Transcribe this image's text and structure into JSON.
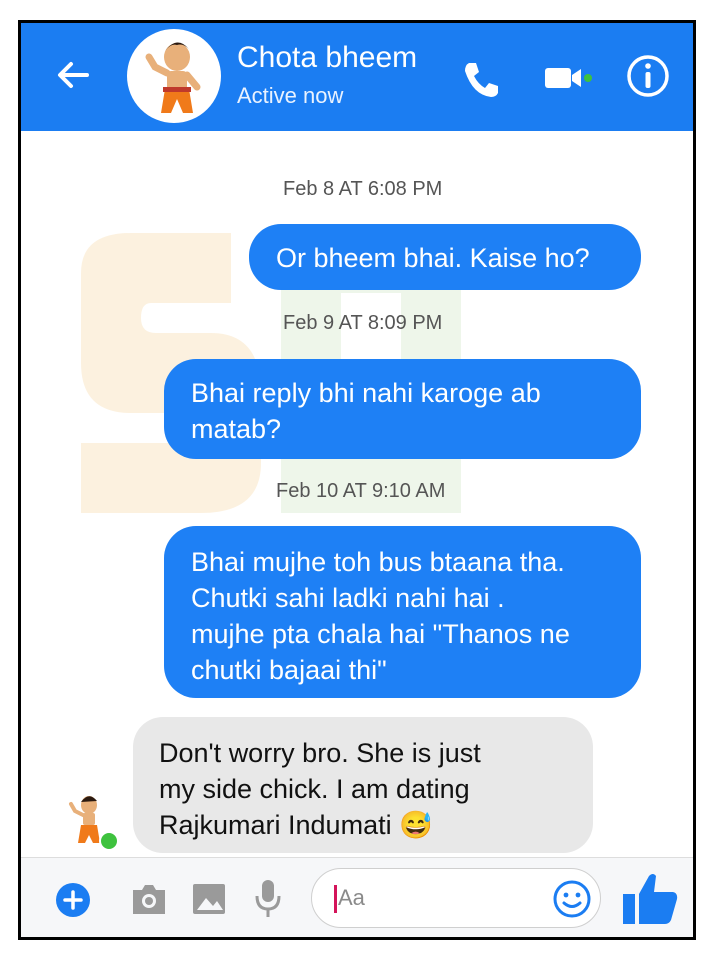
{
  "header": {
    "title": "Chota bheem",
    "status": "Active now"
  },
  "messages": [
    {
      "kind": "timestamp",
      "text": "Feb 8 AT 6:08 PM"
    },
    {
      "kind": "outgoing",
      "text": "Or bheem bhai. Kaise ho?"
    },
    {
      "kind": "timestamp",
      "text": "Feb 9 AT 8:09 PM"
    },
    {
      "kind": "outgoing",
      "text": "Bhai reply bhi nahi karoge ab matab?"
    },
    {
      "kind": "timestamp",
      "text": "Feb 10 AT 9:10 AM"
    },
    {
      "kind": "outgoing",
      "text": "Bhai mujhe toh bus btaana tha. Chutki sahi ladki nahi hai . mujhe pta chala hai \"Thanos ne chutki bajaai thi\""
    },
    {
      "kind": "incoming",
      "text": "Don't worry bro. She is just my side chick. I am dating Rajkumari Indumati 😅"
    }
  ],
  "composer": {
    "placeholder": "Aa"
  },
  "colors": {
    "brand": "#1b7df2",
    "outgoing_bubble": "#1e80f5",
    "incoming_bubble": "#e8e8e8",
    "online": "#3ec23e"
  },
  "icons": [
    "back-arrow-icon",
    "phone-icon",
    "video-call-icon",
    "info-icon",
    "plus-icon",
    "camera-icon",
    "gallery-icon",
    "microphone-icon",
    "emoji-icon",
    "thumbs-up-icon"
  ]
}
